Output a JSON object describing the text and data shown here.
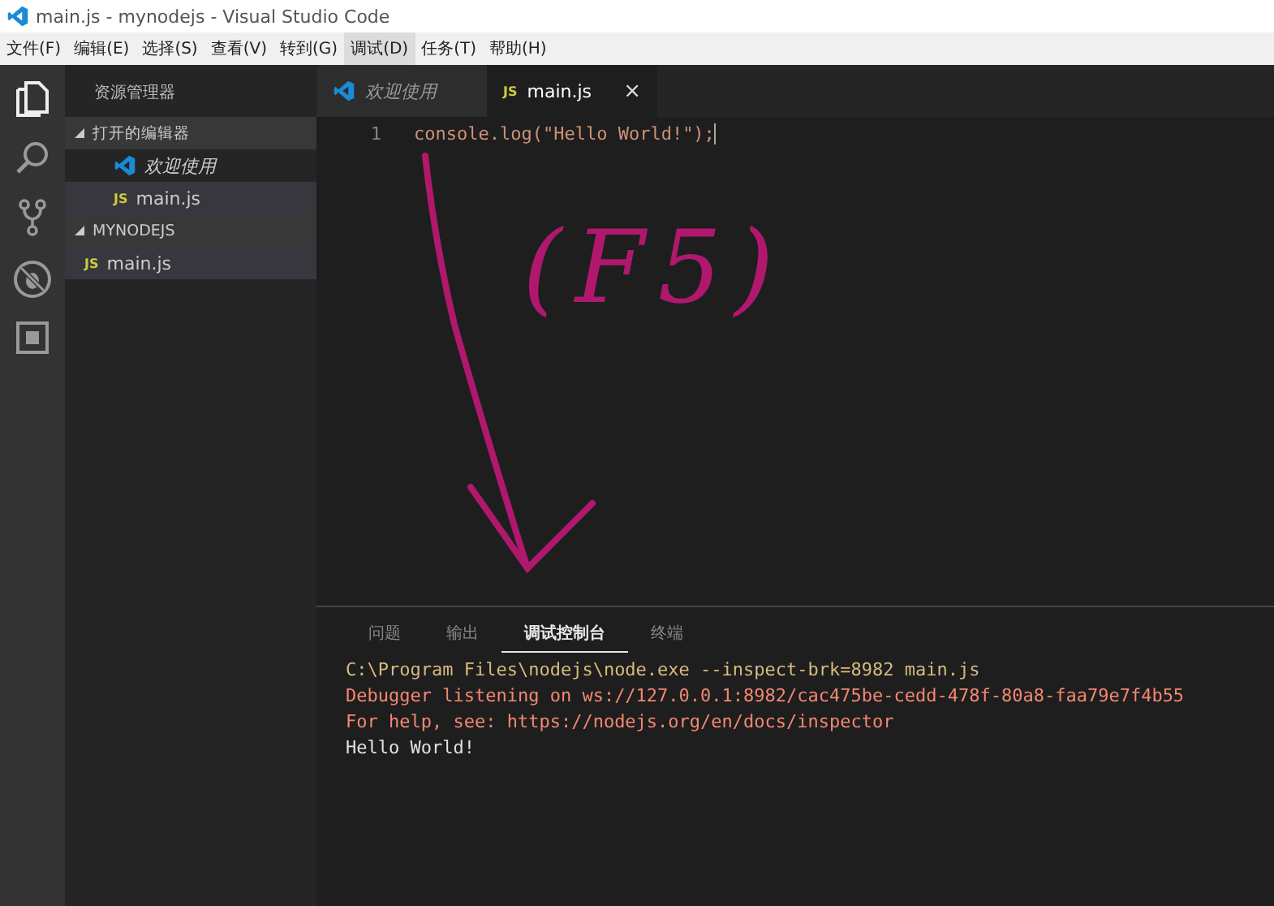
{
  "window": {
    "title": "main.js - mynodejs - Visual Studio Code"
  },
  "menu": [
    {
      "label": "文件(F)",
      "selected": false
    },
    {
      "label": "编辑(E)",
      "selected": false
    },
    {
      "label": "选择(S)",
      "selected": false
    },
    {
      "label": "查看(V)",
      "selected": false
    },
    {
      "label": "转到(G)",
      "selected": false
    },
    {
      "label": "调试(D)",
      "selected": true
    },
    {
      "label": "任务(T)",
      "selected": false
    },
    {
      "label": "帮助(H)",
      "selected": false
    }
  ],
  "sidebar": {
    "title": "资源管理器",
    "sections": [
      {
        "label": "打开的编辑器",
        "expanded": true,
        "items": [
          {
            "label": "欢迎使用",
            "kind": "welcome",
            "preview": true,
            "selected": false
          },
          {
            "label": "main.js",
            "kind": "js",
            "icon_text": "JS",
            "preview": false,
            "selected": true
          }
        ]
      },
      {
        "label": "MYNODEJS",
        "expanded": true,
        "items": [
          {
            "label": "main.js",
            "kind": "js",
            "icon_text": "JS",
            "preview": false,
            "selected": true
          }
        ]
      }
    ]
  },
  "editor": {
    "tabs": [
      {
        "label": "欢迎使用",
        "kind": "welcome",
        "preview": true,
        "selected": false
      },
      {
        "label": "main.js",
        "kind": "js",
        "icon_text": "JS",
        "preview": false,
        "selected": true,
        "close": "×"
      }
    ],
    "lines": [
      {
        "number": "1",
        "code": "console.log(\"Hello World!\");"
      }
    ]
  },
  "panel": {
    "tabs": [
      {
        "label": "问题",
        "selected": false
      },
      {
        "label": "输出",
        "selected": false
      },
      {
        "label": "调试控制台",
        "selected": true
      },
      {
        "label": "终端",
        "selected": false
      }
    ],
    "output": [
      {
        "text": "C:\\Program Files\\nodejs\\node.exe --inspect-brk=8982 main.js",
        "color": "#d7ba7d"
      },
      {
        "text": "Debugger listening on ws://127.0.0.1:8982/cac475be-cedd-478f-80a8-faa79e7f4b55",
        "color": "#f48771"
      },
      {
        "text": "For help, see: https://nodejs.org/en/docs/inspector",
        "color": "#f48771"
      },
      {
        "text": "Hello World!",
        "color": "#e0e0e0"
      }
    ]
  },
  "annotation": {
    "text": "(F5)"
  }
}
